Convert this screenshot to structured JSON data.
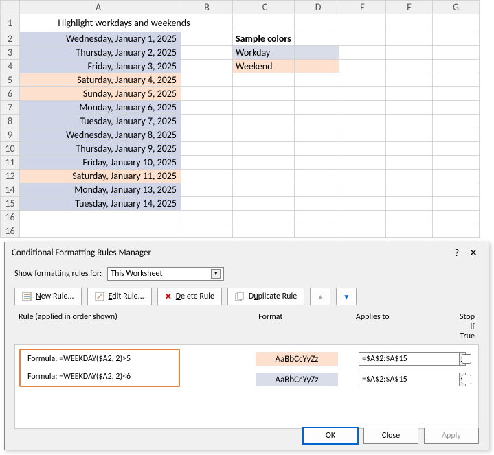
{
  "spreadsheet": {
    "title": "Highlight workdays and weekends",
    "cols": [
      "A",
      "B",
      "C",
      "D",
      "E",
      "F",
      "G"
    ],
    "dates": [
      "Wednesday, January 1, 2025",
      "Thursday, January 2, 2025",
      "Friday, January 3, 2025",
      "Saturday, January 4, 2025",
      "Sunday, January 5, 2025",
      "Monday, January 6, 2025",
      "Tuesday, January 7, 2025",
      "Wednesday, January 8, 2025",
      "Thursday, January 9, 2025",
      "Friday, January 10, 2025",
      "Saturday, January 11, 2025",
      "Monday, January 13, 2025",
      "Tuesday, January 14, 2025"
    ],
    "sample_header": "Sample colors",
    "sample_workday": "Workday",
    "sample_weekend": "Weekend"
  },
  "dialog": {
    "title": "Conditional Formatting Rules Manager",
    "show_label": "Show formatting rules for:",
    "show_value": "This Worksheet",
    "buttons": {
      "new": "New Rule...",
      "edit": "Edit Rule...",
      "delete": "Delete Rule",
      "duplicate": "Duplicate Rule"
    },
    "headers": {
      "rule": "Rule (applied in order shown)",
      "format": "Format",
      "applies": "Applies to",
      "stop": "Stop If True"
    },
    "rules": [
      {
        "formula": "Formula: =WEEKDAY($A2, 2)>5",
        "applies": "=$A$2:$A$15"
      },
      {
        "formula": "Formula: =WEEKDAY($A2, 2)<6",
        "applies": "=$A$2:$A$15"
      }
    ],
    "sample_text": "AaBbCcYyZz",
    "footer": {
      "ok": "OK",
      "close": "Close",
      "apply": "Apply"
    }
  }
}
